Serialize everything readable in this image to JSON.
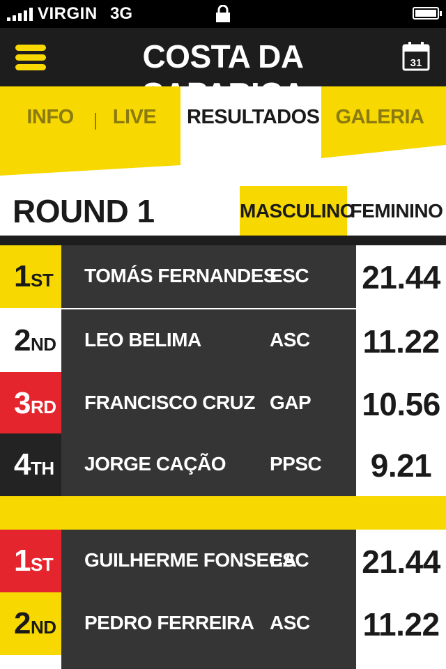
{
  "status_bar": {
    "carrier": "VIRGIN",
    "network": "3G"
  },
  "navbar": {
    "title": "COSTA DA CAPARICA",
    "calendar_day": "31"
  },
  "tabs": [
    {
      "label": "INFO"
    },
    {
      "label": "LIVE"
    },
    {
      "label": "RESULTADOS"
    },
    {
      "label": "GALERIA"
    }
  ],
  "round": {
    "title": "ROUND 1",
    "filter_male": "MASCULINO",
    "filter_female": "FEMININO"
  },
  "heats": [
    {
      "rows": [
        {
          "place_num": "1",
          "place_suffix": "ST",
          "name": "TOMÁS FERNANDES",
          "club": "ESC",
          "score": "21.44",
          "place_color": "#f7d800"
        },
        {
          "place_num": "2",
          "place_suffix": "ND",
          "name": "LEO BELIMA",
          "club": "ASC",
          "score": "11.22",
          "place_color": "#ffffff"
        },
        {
          "place_num": "3",
          "place_suffix": "RD",
          "name": "FRANCISCO CRUZ",
          "club": "GAP",
          "score": "10.56",
          "place_color": "#e4252e"
        },
        {
          "place_num": "4",
          "place_suffix": "TH",
          "name": "JORGE CAÇÃO",
          "club": "PPSC",
          "score": "9.21",
          "place_color": "#232323"
        }
      ]
    },
    {
      "rows": [
        {
          "place_num": "1",
          "place_suffix": "ST",
          "name": "GUILHERME FONSECA",
          "club": "ESC",
          "score": "21.44",
          "place_color": "#e4252e"
        },
        {
          "place_num": "2",
          "place_suffix": "ND",
          "name": "PEDRO FERREIRA",
          "club": "ASC",
          "score": "11.22",
          "place_color": "#f7d800"
        }
      ]
    }
  ],
  "colors": {
    "accent_yellow": "#f7d800",
    "dark": "#1d1d1d",
    "row_gray": "#353535",
    "red": "#e4252e"
  }
}
